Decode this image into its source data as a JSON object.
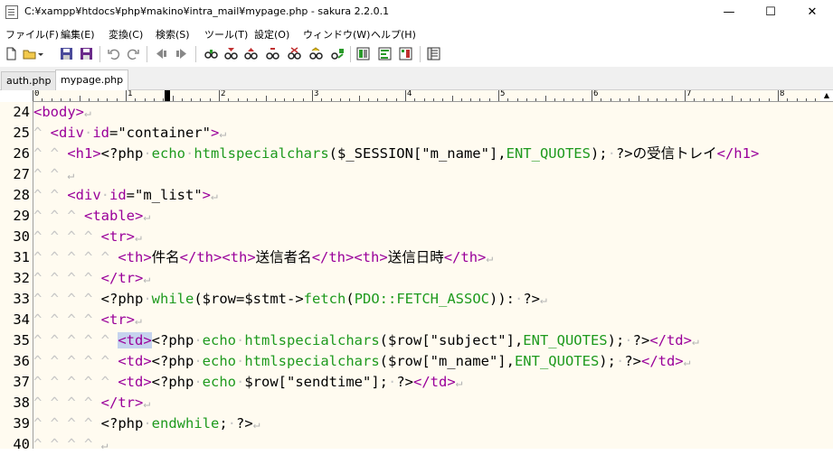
{
  "window": {
    "title": "C:¥xampp¥htdocs¥php¥makino¥intra_mail¥mypage.php - sakura 2.2.0.1",
    "controls": {
      "minimize": "—",
      "maximize": "☐",
      "close": "✕"
    }
  },
  "menubar": {
    "items": [
      "ファイル(F)",
      "編集(E)",
      "変換(C)",
      "検索(S)",
      "ツール(T)",
      "設定(O)",
      "ウィンドウ(W)",
      "ヘルプ(H)"
    ]
  },
  "tabs": [
    {
      "label": "auth.php",
      "active": false
    },
    {
      "label": "mypage.php",
      "active": true
    }
  ],
  "ruler": {
    "numbers": [
      "0",
      "1",
      "2",
      "3",
      "4",
      "5",
      "6",
      "7",
      "8"
    ]
  },
  "editor": {
    "line_numbers": [
      "24",
      "25",
      "26",
      "27",
      "28",
      "29",
      "30",
      "31",
      "32",
      "33",
      "34",
      "35",
      "36",
      "37",
      "38",
      "39",
      "40"
    ],
    "lines": [
      "<body>",
      "  <div id=\"container\">",
      "    <h1><?php echo htmlspecialchars($_SESSION[\"m_name\"],ENT_QUOTES); ?>の受信トレイ</h1>",
      "",
      "    <div id=\"m_list\">",
      "      <table>",
      "        <tr>",
      "          <th>件名</th><th>送信者名</th><th>送信日時</th>",
      "        </tr>",
      "        <?php while($row=$stmt->fetch(PDO::FETCH_ASSOC)): ?>",
      "        <tr>",
      "          <td><?php echo htmlspecialchars($row[\"subject\"],ENT_QUOTES); ?></td>",
      "          <td><?php echo htmlspecialchars($row[\"m_name\"],ENT_QUOTES); ?></td>",
      "          <td><?php echo $row[\"sendtime\"]; ?></td>",
      "        </tr>",
      "        <?php endwhile; ?>",
      ""
    ]
  },
  "colors": {
    "editor_bg": "#fffbf0",
    "tag": "#9a009a",
    "keyword": "#1e9a1e",
    "whitespace_marker": "#c6c6c6",
    "selection": "#c6d3ee"
  }
}
